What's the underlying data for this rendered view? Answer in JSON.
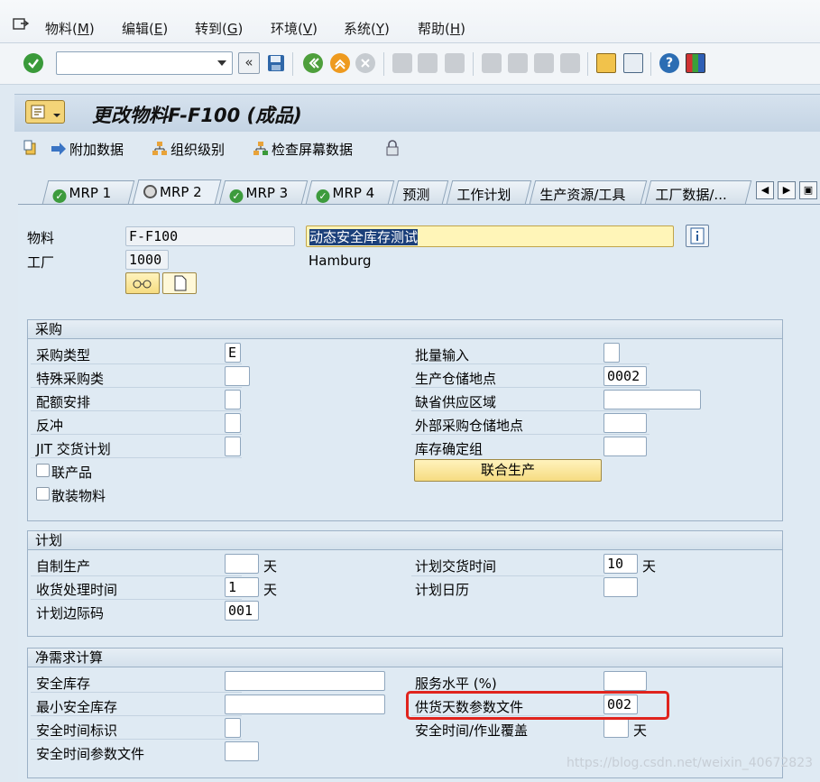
{
  "menu": {
    "items": [
      {
        "text": "物料(",
        "u": "M",
        "close": ")"
      },
      {
        "text": "编辑(",
        "u": "E",
        "close": ")"
      },
      {
        "text": "转到(",
        "u": "G",
        "close": ")"
      },
      {
        "text": "环境(",
        "u": "V",
        "close": ")"
      },
      {
        "text": "系统(",
        "u": "Y",
        "close": ")"
      },
      {
        "text": "帮助(",
        "u": "H",
        "close": ")"
      }
    ]
  },
  "toolbar": {
    "command_value": ""
  },
  "title": "更改物料F-F100 (成品)",
  "app_toolbar": {
    "additional_data": "附加数据",
    "org_levels": "组织级别",
    "check_screen_data": "检查屏幕数据"
  },
  "tabs": [
    "MRP 1",
    "MRP 2",
    "MRP 3",
    "MRP 4",
    "预测",
    "工作计划",
    "生产资源/工具",
    "工厂数据/..."
  ],
  "header": {
    "material_label": "物料",
    "material_value": "F-F100",
    "material_desc": "动态安全库存测试",
    "plant_label": "工厂",
    "plant_value": "1000",
    "plant_name": "Hamburg"
  },
  "procurement": {
    "title": "采购",
    "procurement_type_label": "采购类型",
    "procurement_type_value": "E",
    "special_proc_label": "特殊采购类",
    "quota_label": "配额安排",
    "backflush_label": "反冲",
    "jit_label": "JIT 交货计划",
    "coproduct_label": "联产品",
    "bulk_label": "散装物料",
    "batch_entry_label": "批量输入",
    "prod_stor_loc_label": "生产仓储地点",
    "prod_stor_loc_value": "0002",
    "default_supply_area_label": "缺省供应区域",
    "ext_proc_stor_loc_label": "外部采购仓储地点",
    "stor_determination_label": "库存确定组",
    "joint_production_button": "联合生产"
  },
  "scheduling": {
    "title": "计划",
    "inhouse_label": "自制生产",
    "gr_proc_time_label": "收货处理时间",
    "gr_proc_time_value": "1",
    "sm_key_label": "计划边际码",
    "sm_key_value": "001",
    "planned_delivery_label": "计划交货时间",
    "planned_delivery_value": "10",
    "planning_calendar_label": "计划日历",
    "day_unit": "天"
  },
  "net_req": {
    "title": "净需求计算",
    "safety_stock_label": "安全库存",
    "min_safety_stock_label": "最小安全库存",
    "safety_time_ind_label": "安全时间标识",
    "safety_time_profile_label": "安全时间参数文件",
    "service_level_label": "服务水平 (%)",
    "coverage_profile_label": "供货天数参数文件",
    "coverage_profile_value": "002",
    "safety_time_act_cov_label": "安全时间/作业覆盖",
    "day_unit": "天"
  },
  "watermark": "https://blog.csdn.net/weixin_40672823"
}
